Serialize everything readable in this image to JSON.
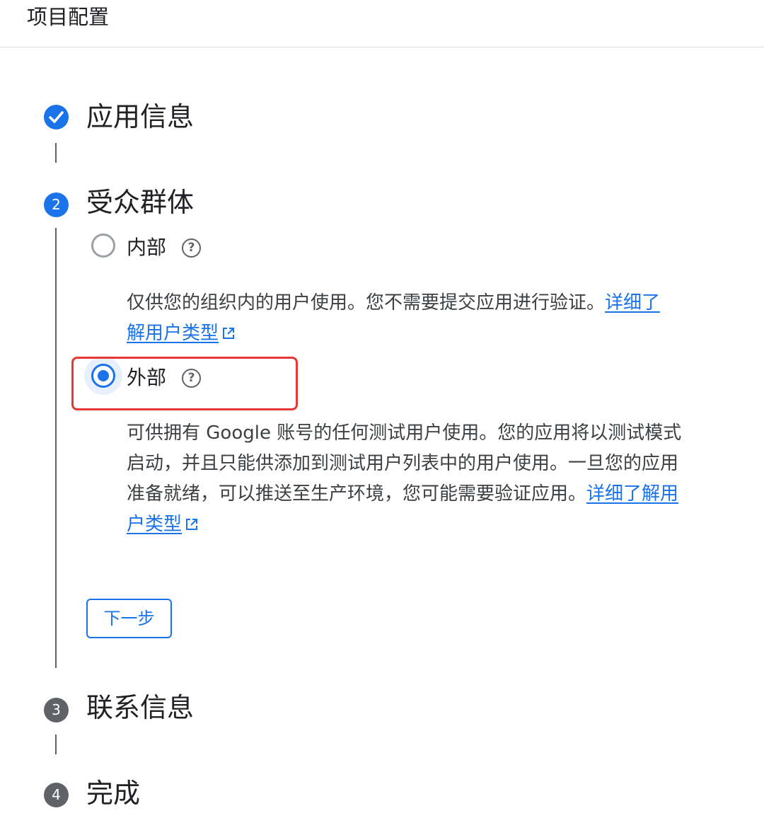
{
  "header": {
    "title": "项目配置"
  },
  "steps": [
    {
      "number": "",
      "title": "应用信息",
      "state": "completed",
      "icon": "check-icon"
    },
    {
      "number": "2",
      "title": "受众群体",
      "state": "active"
    },
    {
      "number": "3",
      "title": "联系信息",
      "state": "pending"
    },
    {
      "number": "4",
      "title": "完成",
      "state": "pending"
    }
  ],
  "audience": {
    "options": [
      {
        "label": "内部",
        "selected": false,
        "description": "仅供您的组织内的用户使用。您不需要提交应用进行验证。",
        "link_text": "详细了解用户类型",
        "help_icon": "help-circle-icon",
        "link_icon": "external-link-icon"
      },
      {
        "label": "外部",
        "selected": true,
        "description": "可供拥有 Google 账号的任何测试用户使用。您的应用将以测试模式启动，并且只能供添加到测试用户列表中的用户使用。一旦您的应用准备就绪，可以推送至生产环境，您可能需要验证应用。",
        "link_text": "详细了解用户类型",
        "help_icon": "help-circle-icon",
        "link_icon": "external-link-icon"
      }
    ],
    "next_button_label": "下一步"
  },
  "colors": {
    "accent": "#1a73e8",
    "step_pending": "#5f6368",
    "highlight": "#e53935"
  }
}
